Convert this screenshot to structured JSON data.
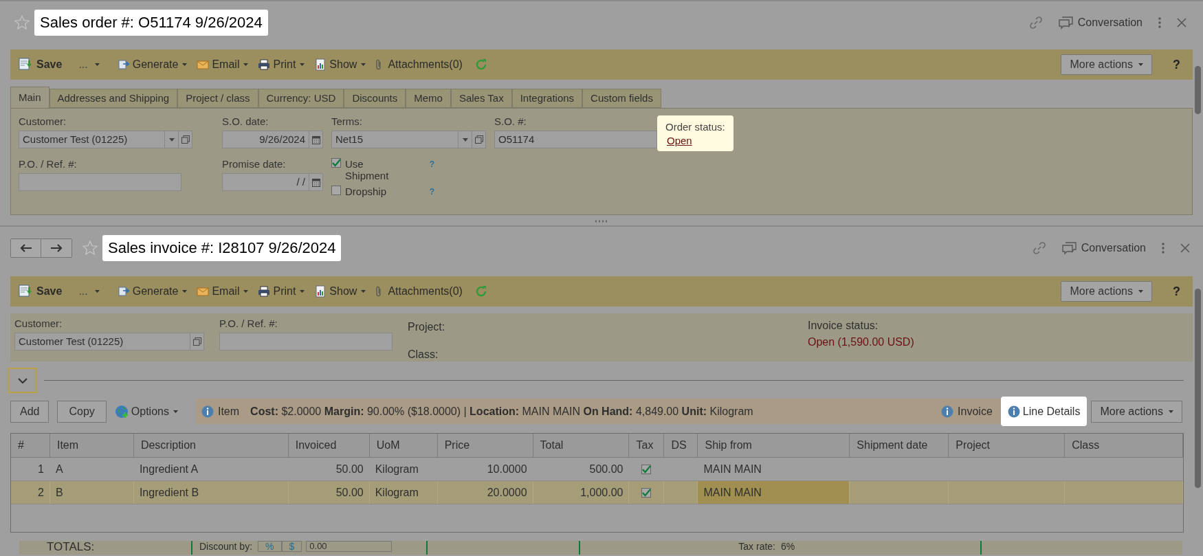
{
  "order": {
    "title": "Sales order #: O51174 9/26/2024",
    "conversation": "Conversation",
    "toolbar": {
      "save": "Save",
      "more": "...",
      "menus": [
        "Generate",
        "Email",
        "Print",
        "Show"
      ],
      "attachments": "Attachments(0)",
      "more_actions": "More actions",
      "help": "?"
    },
    "tabs": [
      {
        "label": "Main",
        "selected": true
      },
      {
        "label": "Addresses and Shipping",
        "selected": false
      },
      {
        "label": "Project / class",
        "selected": false
      },
      {
        "label": "Currency: USD",
        "selected": false
      },
      {
        "label": "Discounts",
        "selected": false
      },
      {
        "label": "Memo",
        "selected": false
      },
      {
        "label": "Sales Tax",
        "selected": false
      },
      {
        "label": "Integrations",
        "selected": false
      },
      {
        "label": "Custom fields",
        "selected": false
      }
    ],
    "customer": {
      "label": "Customer:",
      "value": "Customer Test (01225)"
    },
    "so_date": {
      "label": "S.O. date:",
      "value": "9/26/2024"
    },
    "terms": {
      "label": "Terms:",
      "value": "Net15"
    },
    "so_number": {
      "label": "S.O. #:",
      "value": "O51174"
    },
    "order_status": {
      "label": "Order status:",
      "value": "Open"
    },
    "po_ref": {
      "label": "P.O. / Ref. #:"
    },
    "promise_date": {
      "label": "Promise date:",
      "value": "/  /"
    },
    "checkboxes": [
      {
        "label": "Use Shipment",
        "checked": true,
        "help": "?"
      },
      {
        "label": "Dropship",
        "checked": false,
        "help": "?"
      }
    ]
  },
  "invoice": {
    "title": "Sales invoice #: I28107 9/26/2024",
    "conversation": "Conversation",
    "toolbar": {
      "save": "Save",
      "more": "...",
      "menus": [
        "Generate",
        "Email",
        "Print",
        "Show"
      ],
      "attachments": "Attachments(0)",
      "more_actions": "More actions",
      "help": "?"
    },
    "customer": {
      "label": "Customer:",
      "value": "Customer Test (01225)"
    },
    "po_ref": {
      "label": "P.O. / Ref. #:"
    },
    "project": {
      "label": "Project:"
    },
    "class": {
      "label": "Class:"
    },
    "invoice_status": {
      "label": "Invoice status:",
      "value": "Open (1,590.00 USD)"
    },
    "line_actions": {
      "add": "Add",
      "copy": "Copy",
      "options": "Options",
      "item": "Item",
      "info": "**Cost:** $2.0000 **Margin:** 90.00% ($18.0000) | **Location:** MAIN MAIN **On Hand:** 4,849.00 **Unit:** Kilogram",
      "invoice": "Invoice",
      "line_details": "Line Details",
      "more_actions": "More actions"
    },
    "table": {
      "columns": [
        "#",
        "Item",
        "Description",
        "Invoiced",
        "UoM",
        "Price",
        "Total",
        "Tax",
        "DS",
        "Ship from",
        "Shipment date",
        "Project",
        "Class"
      ],
      "rows": [
        {
          "number": "1",
          "item": "A",
          "description": "Ingredient A",
          "invoiced": "50.00",
          "uom": "Kilogram",
          "price": "10.0000",
          "total": "500.00",
          "tax": true,
          "ship_from": "MAIN MAIN",
          "selected": false
        },
        {
          "number": "2",
          "item": "B",
          "description": "Ingredient B",
          "invoiced": "50.00",
          "uom": "Kilogram",
          "price": "20.0000",
          "total": "1,000.00",
          "tax": true,
          "ship_from": "MAIN MAIN",
          "selected": true
        }
      ]
    },
    "totals": {
      "label": "TOTALS:",
      "discount_label": "Discount by:",
      "discount_modes": [
        "%",
        "$"
      ],
      "discount_value": "0.00",
      "tax_rate_label": "Tax rate:",
      "tax_rate": "6%"
    }
  }
}
